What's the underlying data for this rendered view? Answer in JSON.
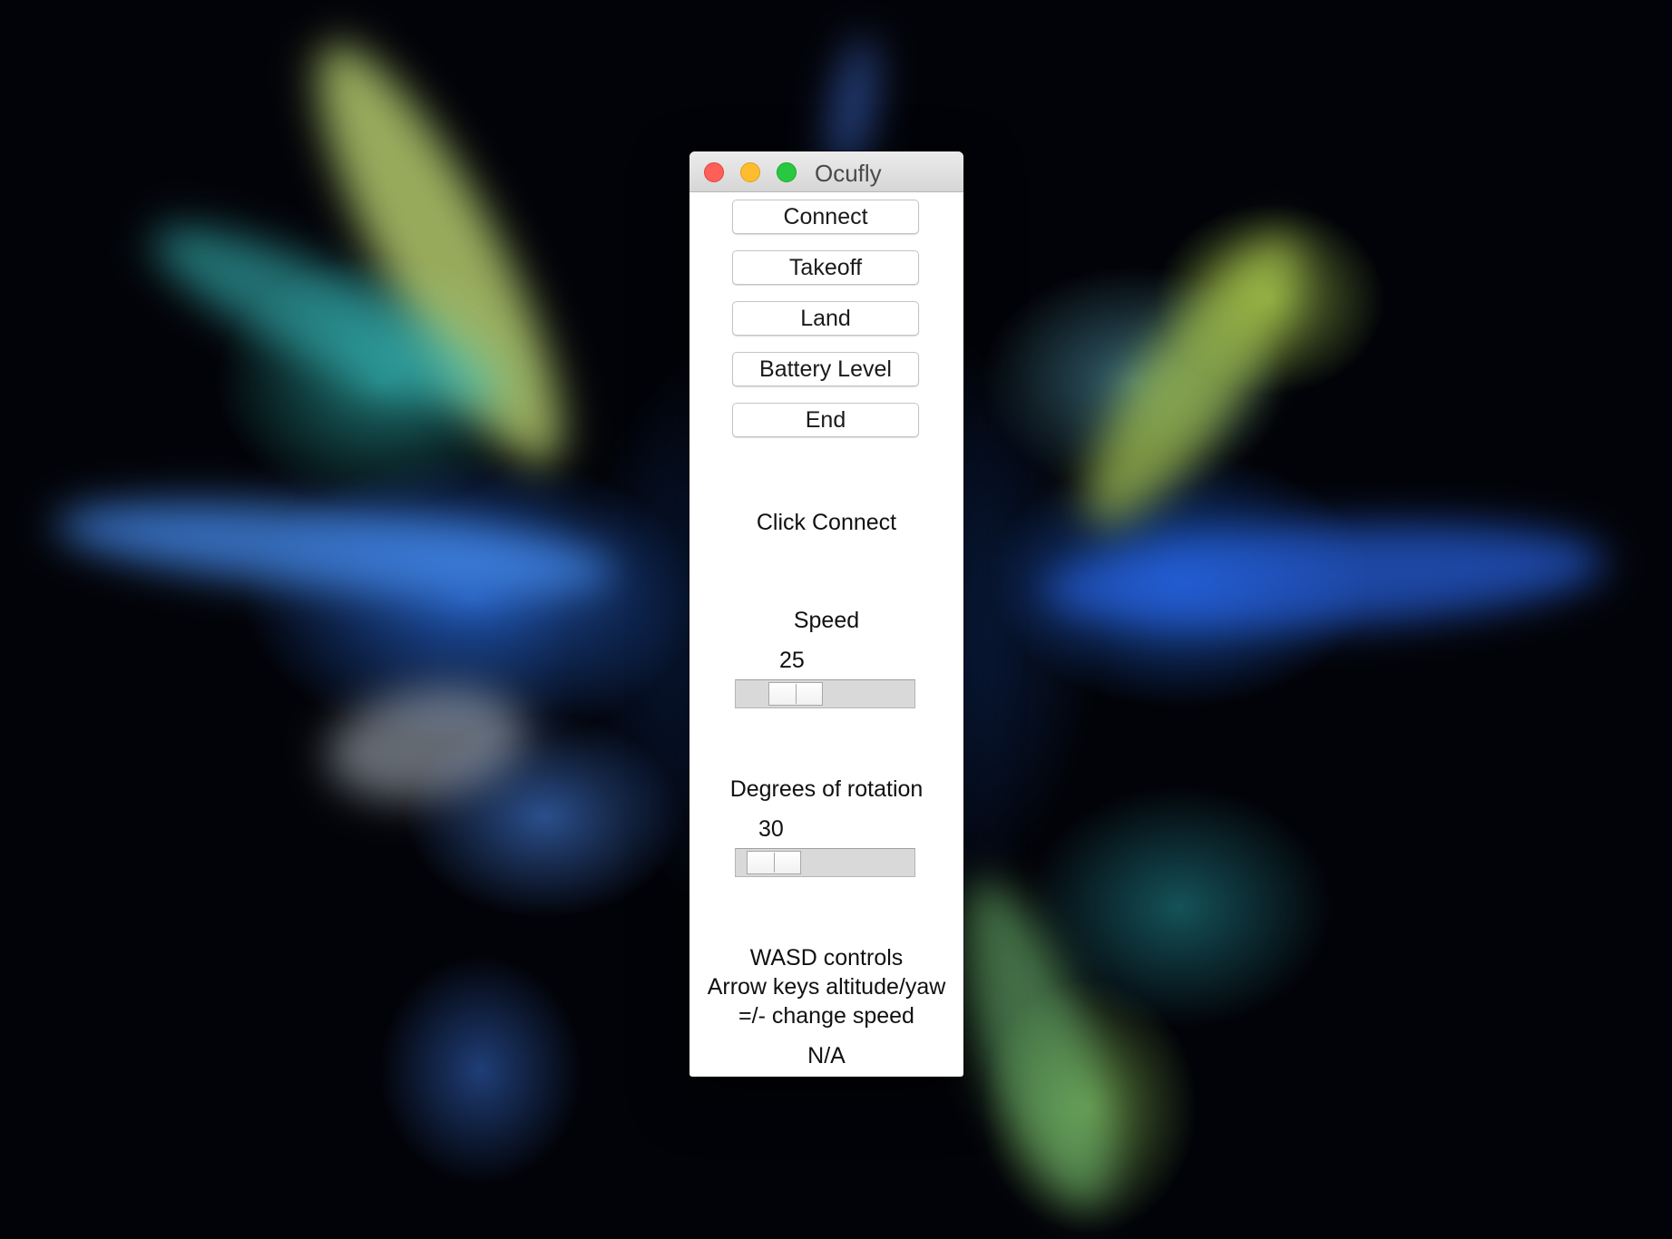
{
  "window": {
    "title": "Ocufly"
  },
  "buttons": {
    "connect": "Connect",
    "takeoff": "Takeoff",
    "land": "Land",
    "battery_level": "Battery Level",
    "end": "End"
  },
  "status": {
    "message": "Click Connect"
  },
  "speed": {
    "label": "Speed",
    "value": "25"
  },
  "rotation": {
    "label": "Degrees of rotation",
    "value": "30"
  },
  "instructions": {
    "line1": "WASD controls",
    "line2": "Arrow keys altitude/yaw",
    "line3": "=/- change speed"
  },
  "battery": {
    "value": "N/A"
  }
}
